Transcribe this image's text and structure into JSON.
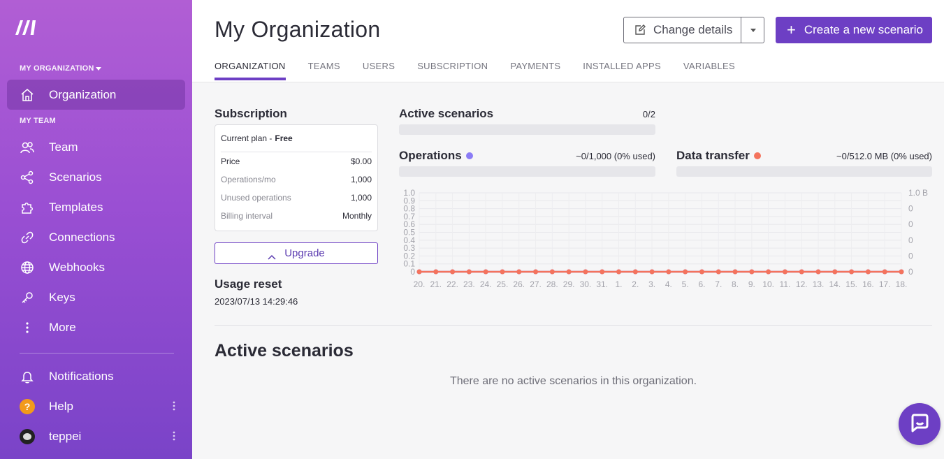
{
  "sidebar": {
    "org_label": "MY ORGANIZATION",
    "team_label": "MY TEAM",
    "org_item": "Organization",
    "items": [
      {
        "label": "Team",
        "icon": "users-icon"
      },
      {
        "label": "Scenarios",
        "icon": "share-icon"
      },
      {
        "label": "Templates",
        "icon": "puzzle-icon"
      },
      {
        "label": "Connections",
        "icon": "link-icon"
      },
      {
        "label": "Webhooks",
        "icon": "globe-icon"
      },
      {
        "label": "Keys",
        "icon": "key-icon"
      },
      {
        "label": "More",
        "icon": "more-vertical-icon"
      }
    ],
    "bottom": {
      "notifications": "Notifications",
      "help": "Help",
      "help_glyph": "?",
      "user": "teppei"
    }
  },
  "header": {
    "title": "My Organization",
    "change_details": "Change details",
    "create_scenario": "Create a new scenario",
    "tabs": [
      "ORGANIZATION",
      "TEAMS",
      "USERS",
      "SUBSCRIPTION",
      "PAYMENTS",
      "INSTALLED APPS",
      "VARIABLES"
    ],
    "active_tab": "ORGANIZATION"
  },
  "subscription": {
    "title": "Subscription",
    "plan_label": "Current plan -",
    "plan_value": "Free",
    "rows": [
      {
        "key": "Price",
        "value": "$0.00"
      },
      {
        "key": "Operations/mo",
        "value": "1,000"
      },
      {
        "key": "Unused operations",
        "value": "1,000"
      },
      {
        "key": "Billing interval",
        "value": "Monthly"
      }
    ],
    "upgrade": "Upgrade",
    "usage_reset_title": "Usage reset",
    "usage_reset_date": "2023/07/13 14:29:46"
  },
  "metrics": {
    "active_scenarios": {
      "title": "Active scenarios",
      "value": "0/2",
      "fraction": 0
    },
    "operations": {
      "title": "Operations",
      "value": "~0/1,000 (0% used)",
      "fraction": 0,
      "color": "#8b7cf6"
    },
    "data_transfer": {
      "title": "Data transfer",
      "value": "~0/512.0 MB (0% used)",
      "fraction": 0,
      "color": "#f4735d"
    }
  },
  "chart_data": {
    "type": "line",
    "x": [
      "20.",
      "21.",
      "22.",
      "23.",
      "24.",
      "25.",
      "26.",
      "27.",
      "28.",
      "29.",
      "30.",
      "31.",
      "1.",
      "2.",
      "3.",
      "4.",
      "5.",
      "6.",
      "7.",
      "8.",
      "9.",
      "10.",
      "11.",
      "12.",
      "13.",
      "14.",
      "15.",
      "16.",
      "17.",
      "18."
    ],
    "y_left_ticks": [
      "0",
      "0.1",
      "0.2",
      "0.3",
      "0.4",
      "0.5",
      "0.6",
      "0.7",
      "0.8",
      "0.9",
      "1.0"
    ],
    "y_right_ticks": [
      "0",
      "0",
      "0",
      "0",
      "0",
      "1.0 B"
    ],
    "ylim": [
      0,
      1
    ],
    "series": [
      {
        "values": [
          0,
          0,
          0,
          0,
          0,
          0,
          0,
          0,
          0,
          0,
          0,
          0,
          0,
          0,
          0,
          0,
          0,
          0,
          0,
          0,
          0,
          0,
          0,
          0,
          0,
          0,
          0,
          0,
          0,
          0
        ],
        "color": "#f4735d"
      },
      {
        "values": [
          0,
          0,
          0,
          0,
          0,
          0,
          0,
          0,
          0,
          0,
          0,
          0,
          0,
          0,
          0,
          0,
          0,
          0,
          0,
          0,
          0,
          0,
          0,
          0,
          0,
          0,
          0,
          0,
          0,
          0
        ],
        "color": "#8b7cf6"
      }
    ],
    "grid": true
  },
  "active_scenarios_section": {
    "title": "Active scenarios",
    "empty": "There are no active scenarios in this organization."
  }
}
